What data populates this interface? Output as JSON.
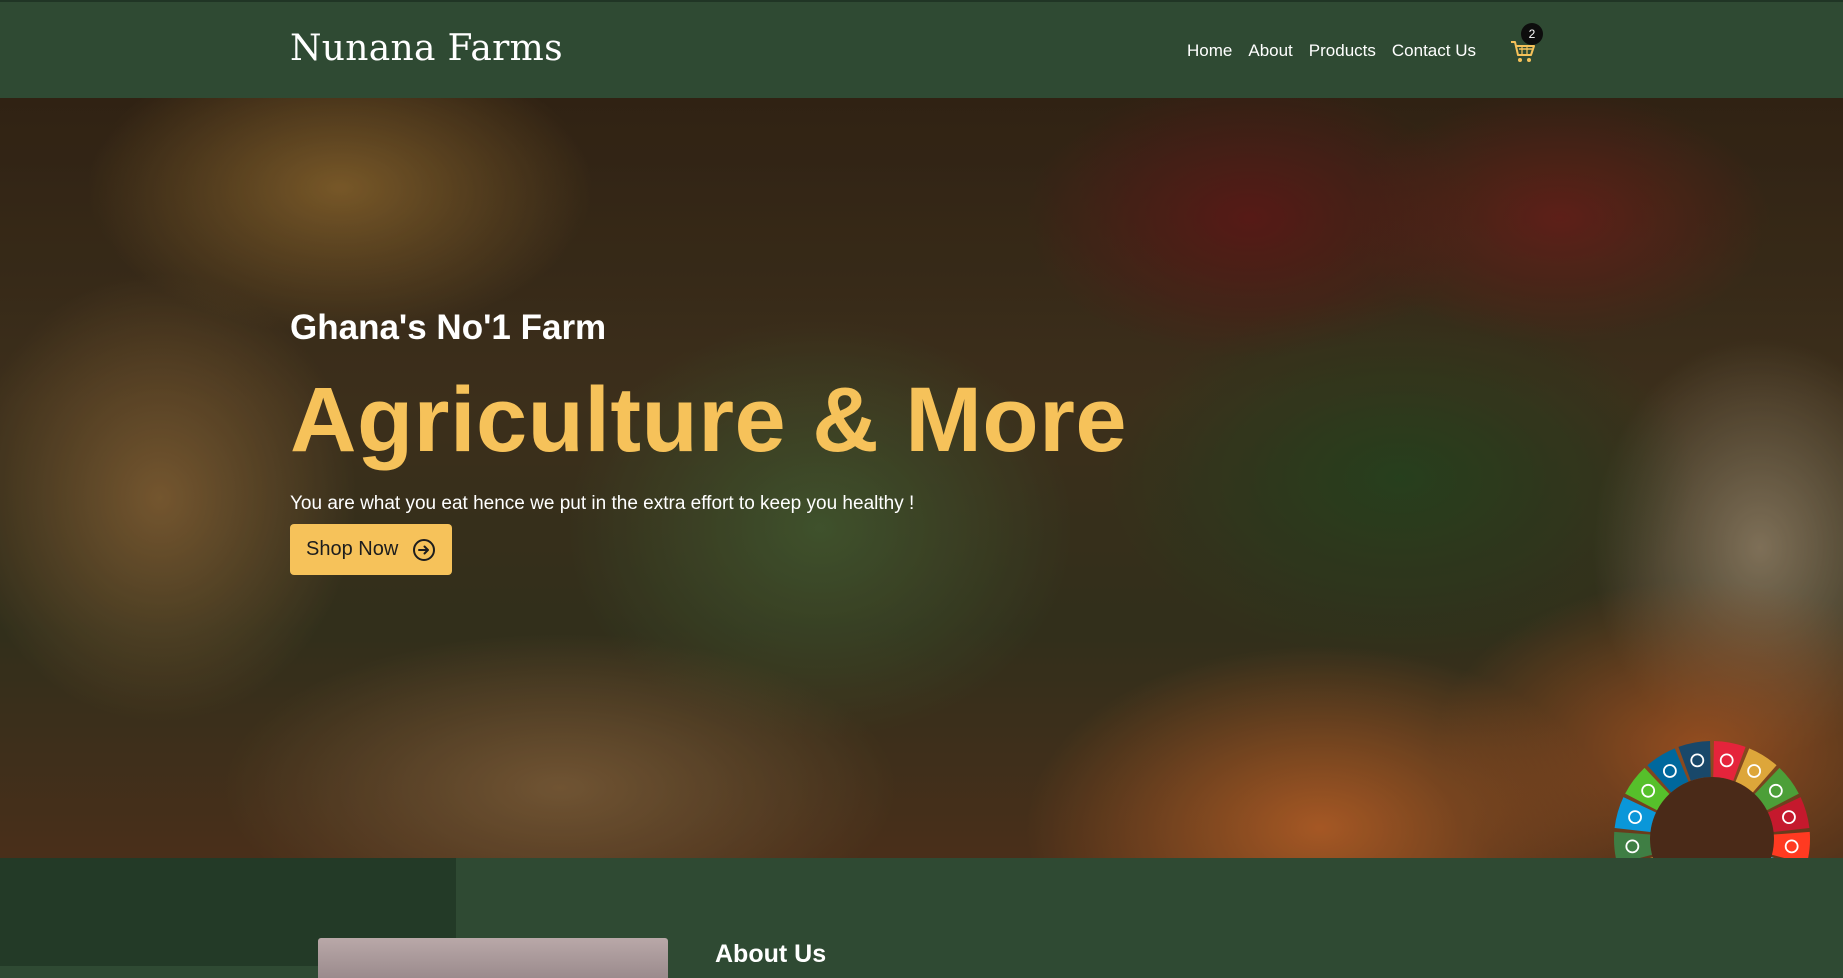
{
  "header": {
    "brand": "Nunana Farms",
    "nav": [
      "Home",
      "About",
      "Products",
      "Contact Us"
    ],
    "cart_icon": "cart-icon",
    "cart_count": "2",
    "accent_color": "#f6c25a"
  },
  "hero": {
    "kicker": "Ghana's No'1 Farm",
    "headline": "Agriculture & More",
    "tagline": "You are what you eat hence we put in the extra effort to keep you healthy !",
    "cta_label": "Shop Now",
    "cta_icon": "arrow-right-circle-icon",
    "headline_color": "#f6c25a",
    "background_icon": "vegetables-market-photo",
    "badge_icon": "sdg-wheel-icon"
  },
  "about": {
    "heading": "About Us"
  },
  "colors": {
    "nav_bg": "#2f4a33",
    "section_dark": "#233a27"
  }
}
